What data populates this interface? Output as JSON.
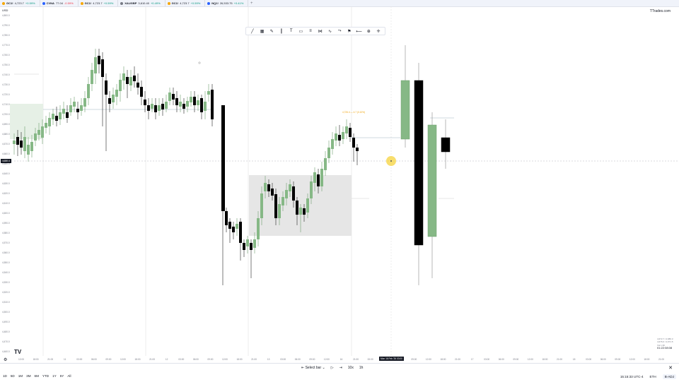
{
  "tabs": [
    {
      "symbol": "GC1!",
      "price": "4,723.7",
      "change": "+0.59%",
      "negative": false,
      "dot": "#f7a600"
    },
    {
      "symbol": "CVNA",
      "price": "77.04",
      "change": "-0.59%",
      "negative": true,
      "dot": "#2962ff"
    },
    {
      "symbol": "GC1!",
      "price": "4,723.7",
      "change": "+0.59%",
      "negative": false,
      "dot": "#f7a600"
    },
    {
      "symbol": "XAUGBP",
      "price": "3,610.40",
      "change": "+0.49%",
      "negative": false,
      "dot": "#787b86"
    },
    {
      "symbol": "GC1!",
      "price": "4,723.7",
      "change": "+0.59%",
      "negative": false,
      "dot": "#f7a600"
    },
    {
      "symbol": "NQ1!",
      "price": "26,533.75",
      "change": "+0.41%",
      "negative": false,
      "dot": "#2962ff"
    }
  ],
  "tab_add": "+",
  "brand": "TTrades.com",
  "currency": "USD",
  "price_axis": [
    "4,800.0",
    "4,790.0",
    "4,780.0",
    "4,770.0",
    "4,760.0",
    "4,750.0",
    "4,740.0",
    "4,730.0",
    "4,720.0",
    "4,710.0",
    "4,700.0",
    "4,690.0",
    "4,680.0",
    "4,670.0",
    "4,660.0",
    "4,650.0",
    "4,640.0",
    "4,630.0",
    "4,620.0",
    "4,610.0",
    "4,600.0",
    "4,590.0",
    "4,580.0",
    "4,570.0",
    "4,560.0",
    "4,550.0",
    "4,540.0",
    "4,530.0",
    "4,520.0",
    "4,510.0",
    "4,500.0",
    "4,490.0",
    "4,480.0",
    "4,470.0",
    "4,460.0"
  ],
  "crosshair_price": "4,659.4",
  "time_axis": [
    "12:00",
    "18:00",
    "21:00",
    "11",
    "03:00",
    "06:00",
    "09:00",
    "12:00",
    "18:00",
    "21:00",
    "12",
    "03:00",
    "06:00",
    "09:00",
    "12:00",
    "18:00",
    "21:00",
    "13",
    "03:00",
    "06:00",
    "09:00",
    "12:00",
    "16",
    "21:00",
    "00:00",
    "03:00",
    "06:00",
    "09:00",
    "12:00",
    "18:00",
    "21:00",
    "17",
    "03:00",
    "06:00",
    "09:00",
    "12:00",
    "18:00",
    "21:00",
    "18",
    "03:00",
    "06:00",
    "09:00",
    "12:00",
    "18:00",
    "21:00"
  ],
  "crosshair_time": "Mon 16 Feb '26  03:00",
  "floating_label": "4,726.4 — 4.7 (0.10%)",
  "info": [
    "4,672.7 / 4,686.3",
    "4,676.0 / 4,671.5",
    "Vol 1.3K"
  ],
  "info_time": "01:22:08:08",
  "replay": {
    "select_bar": "Select bar",
    "speed": "10x",
    "interval": "1h"
  },
  "ranges": [
    "1D",
    "5D",
    "1M",
    "3M",
    "6M",
    "YTD",
    "1Y",
    "5Y",
    "All"
  ],
  "status": {
    "clock": "15:15:33 UTC-4",
    "session": "ETH",
    "adj": "B-ADJ"
  },
  "colors": {
    "bull": "#86b886",
    "bear": "#000000",
    "zone": "#e6e6e6",
    "marker": "#f5d33c",
    "accent": "#2962ff"
  },
  "icons": [
    "trend-line-icon",
    "pitchfork-icon",
    "brush-icon",
    "vertical-line-icon",
    "text-icon",
    "rectangle-icon",
    "fib-icon",
    "pattern-icon",
    "path-icon",
    "measure-icon",
    "flag-icon",
    "arrow-icon",
    "plus-circle-icon",
    "crosshair-icon"
  ]
}
